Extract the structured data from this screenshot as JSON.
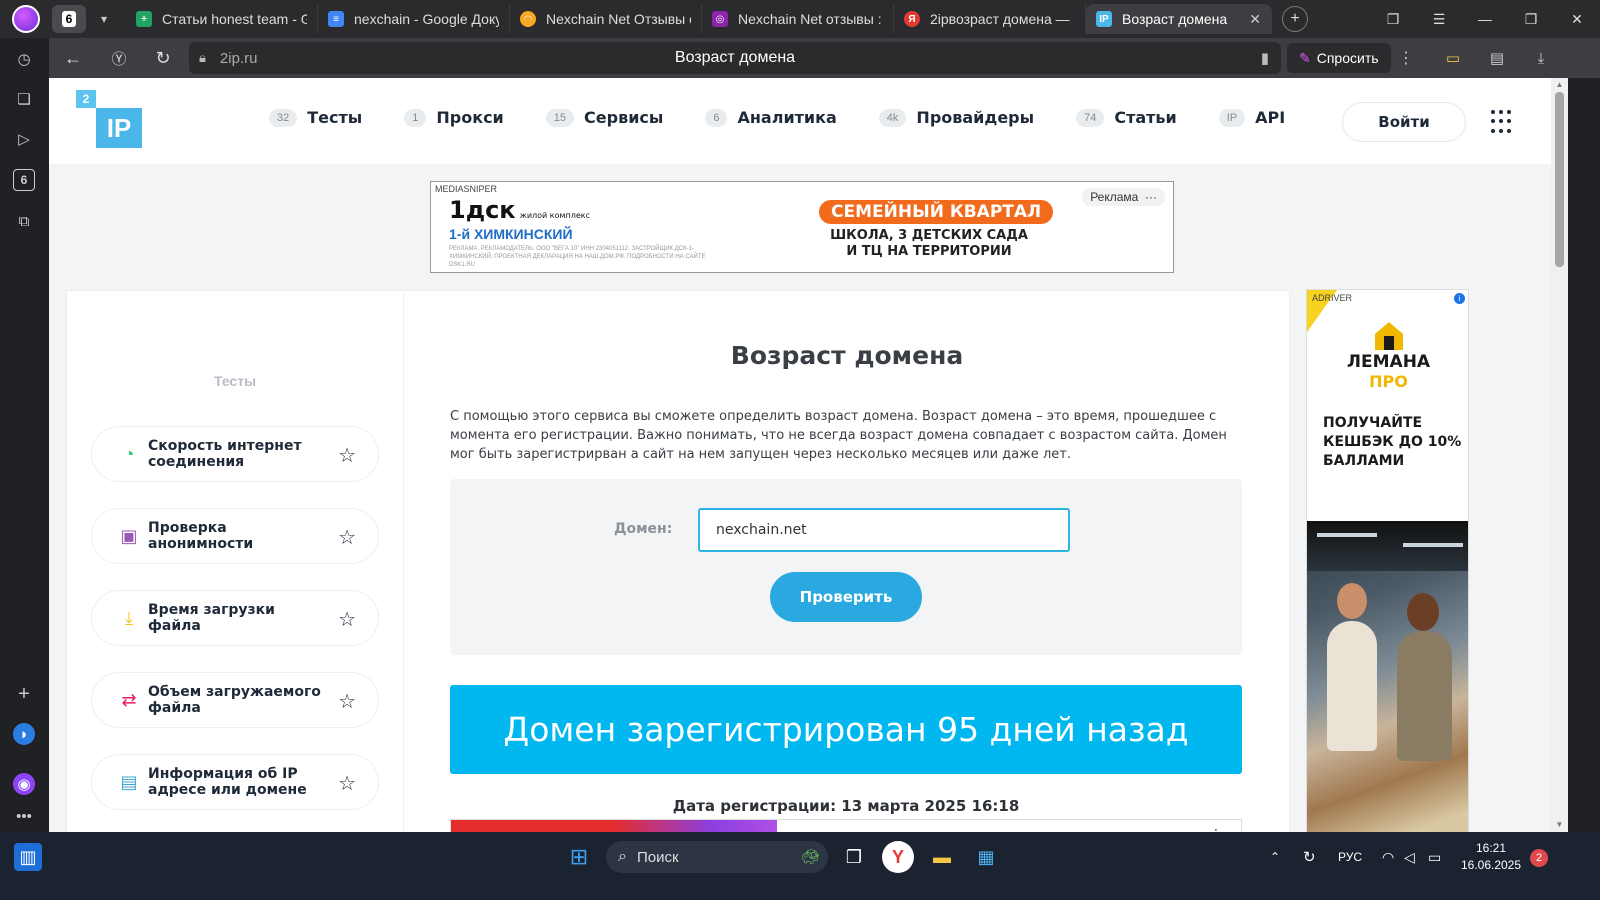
{
  "browser": {
    "tab_group_count": "6",
    "tabs": [
      {
        "label": "Статьи honest team - Go",
        "icon_color": "#1fa463",
        "icon_name": "sheets-icon"
      },
      {
        "label": "nexchain - Google Доку",
        "icon_color": "#4285f4",
        "icon_name": "docs-icon"
      },
      {
        "label": "Nexchain Net Отзывы о",
        "icon_color": "#f9a825",
        "icon_name": "otzovik-icon"
      },
      {
        "label": "Nexchain Net отзывы : р",
        "icon_color": "#8e24aa",
        "icon_name": "review-site-icon"
      },
      {
        "label": "2ipвозраст домена —",
        "icon_color": "#e53935",
        "icon_name": "yandex-icon"
      },
      {
        "label": "Возраст домена",
        "icon_color": "#4ab6ea",
        "icon_name": "2ip-icon"
      }
    ],
    "address": {
      "domain": "2ip.ru",
      "page_title": "Возраст домена"
    },
    "ask_label": "Спросить"
  },
  "site": {
    "logo_small": "2",
    "logo_big": "IP",
    "nav": [
      {
        "count": "32",
        "label": "Тесты"
      },
      {
        "count": "1",
        "label": "Прокси"
      },
      {
        "count": "15",
        "label": "Сервисы"
      },
      {
        "count": "6",
        "label": "Аналитика"
      },
      {
        "count": "4k",
        "label": "Провайдеры"
      },
      {
        "count": "74",
        "label": "Статьи"
      },
      {
        "count": "IP",
        "label": "API"
      }
    ],
    "login_label": "Войти"
  },
  "top_ad": {
    "source": "MEDIASNIPER",
    "brand": "1дск",
    "brand_tag": "жилой комплекс",
    "project": "1-й ХИМКИНСКИЙ",
    "fine_print": "РЕКЛАМА. РЕКЛАМОДАТЕЛЬ: ООО \"ВЕГА 10\" ИНН 2304051112. ЗАСТРОЙЩИК ДСК-1-ХИМКИНСКИЙ. ПРОЕКТНАЯ ДЕКЛАРАЦИЯ НА НАШ.ДОМ.РФ. ПОДРОБНОСТИ НА САЙТЕ DSK1.RU",
    "headline": "СЕМЕЙНЫЙ КВАРТАЛ",
    "sub1": "ШКОЛА, 3 ДЕТСКИХ САДА",
    "sub2": "И ТЦ НА ТЕРРИТОРИИ",
    "label": "Реклама",
    "label_more": "···"
  },
  "sidebar": {
    "title": "Тесты",
    "items": [
      {
        "label": "Скорость интернет соединения",
        "icon": "speedometer-icon",
        "color": "#2ecc71"
      },
      {
        "label": "Проверка анонимности",
        "icon": "anonymity-icon",
        "color": "#9b59b6"
      },
      {
        "label": "Время загрузки файла",
        "icon": "download-icon",
        "color": "#f1c40f"
      },
      {
        "label": "Объем загружаемого файла",
        "icon": "upload-size-icon",
        "color": "#e91e63"
      },
      {
        "label": "Информация об IP адресе или домене",
        "icon": "document-icon",
        "color": "#3aa6d8"
      }
    ]
  },
  "main": {
    "title": "Возраст домена",
    "description": "С помощью этого сервиса вы сможете определить возраст домена. Возраст домена – это время, прошедшее с момента его регистрации. Важно понимать, что не всегда возраст домена совпадает с возрастом сайта. Домен мог быть зарегистрирван а сайт на нем запущен через несколько месяцев или даже лет.",
    "domain_label": "Домен:",
    "domain_value": "nexchain.net",
    "check_label": "Проверить",
    "result": "Домен зарегистрирован 95 дней назад",
    "registration_date": "Дата регистрации: 13 марта 2025 16:18"
  },
  "right_ad": {
    "source": "ADRIVER",
    "brand_line1": "ЛЕМАНА",
    "brand_line2": "ПРО",
    "promo": "ПОЛУЧАЙТЕ КЕШБЭК ДО 10% БАЛЛАМИ",
    "accent_color": "#f2b700"
  },
  "taskbar": {
    "search_label": "Поиск",
    "language": "РУС",
    "time": "16:21",
    "date": "16.06.2025",
    "notifications": "2"
  }
}
